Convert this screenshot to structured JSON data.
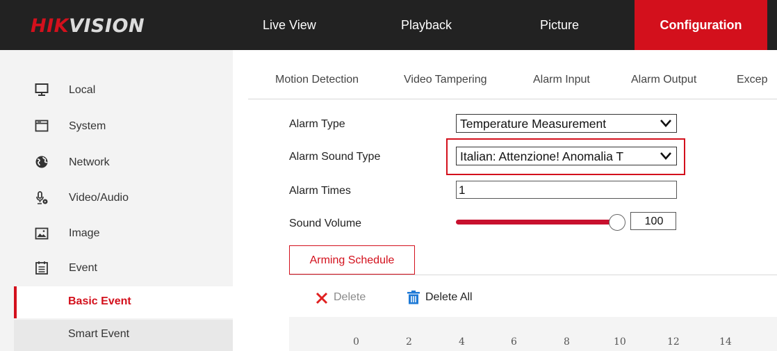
{
  "header": {
    "logo_part1": "HIK",
    "logo_part2": "VISION",
    "nav": [
      {
        "label": "Live View"
      },
      {
        "label": "Playback"
      },
      {
        "label": "Picture"
      },
      {
        "label": "Configuration"
      }
    ],
    "active_nav": "Configuration",
    "brand_color": "#d3101c"
  },
  "sidebar": {
    "items": [
      {
        "label": "Local",
        "icon": "monitor-icon"
      },
      {
        "label": "System",
        "icon": "window-icon"
      },
      {
        "label": "Network",
        "icon": "globe-icon"
      },
      {
        "label": "Video/Audio",
        "icon": "microphone-icon"
      },
      {
        "label": "Image",
        "icon": "image-icon"
      },
      {
        "label": "Event",
        "icon": "calendar-icon"
      }
    ],
    "sub_items": [
      {
        "label": "Basic Event",
        "active": true
      },
      {
        "label": "Smart Event",
        "active": false
      }
    ]
  },
  "tabs": [
    {
      "label": "Motion Detection"
    },
    {
      "label": "Video Tampering"
    },
    {
      "label": "Alarm Input"
    },
    {
      "label": "Alarm Output"
    },
    {
      "label": "Excep"
    }
  ],
  "form": {
    "alarm_type_label": "Alarm Type",
    "alarm_type_value": "Temperature Measurement",
    "alarm_sound_label": "Alarm Sound Type",
    "alarm_sound_value": "Italian: Attenzione! Anomalia T",
    "alarm_times_label": "Alarm Times",
    "alarm_times_value": "1",
    "sound_volume_label": "Sound Volume",
    "sound_volume_value": "100",
    "sound_volume_level": 1.0
  },
  "schedule": {
    "tab_label": "Arming Schedule",
    "delete_label": "Delete",
    "delete_all_label": "Delete All",
    "hours": [
      "0",
      "2",
      "4",
      "6",
      "8",
      "10",
      "12",
      "14"
    ]
  }
}
